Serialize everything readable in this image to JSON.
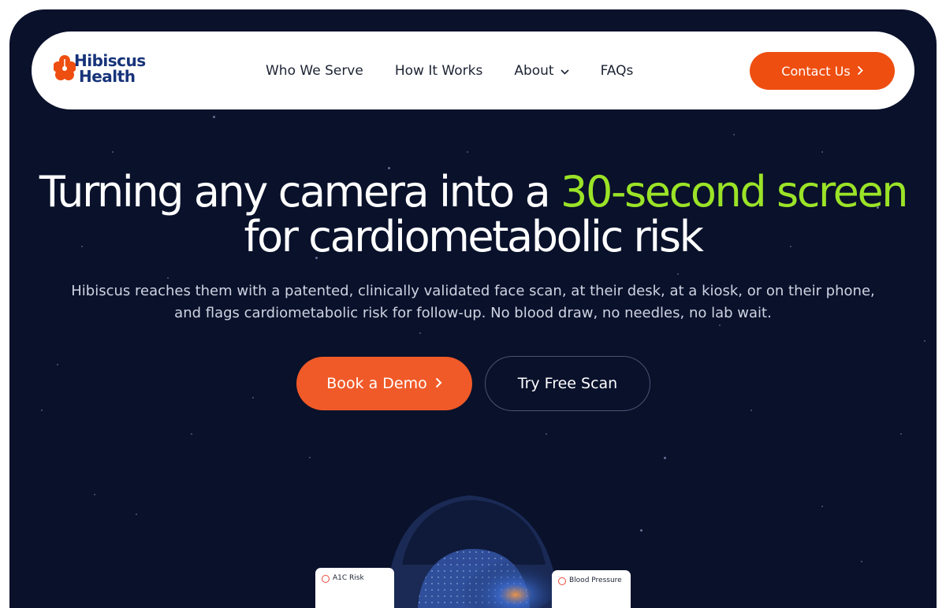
{
  "brand": {
    "name_line1": "Hibiscus",
    "name_line2": "Health",
    "brand_color": "#17337a",
    "flower_color": "#ee4e10"
  },
  "nav": {
    "links": [
      {
        "label": "Who We Serve",
        "has_dropdown": false
      },
      {
        "label": "How It Works",
        "has_dropdown": false
      },
      {
        "label": "About",
        "has_dropdown": true
      },
      {
        "label": "FAQs",
        "has_dropdown": false
      }
    ],
    "contact_label": "Contact Us",
    "contact_icon": "chevron-right-icon"
  },
  "hero": {
    "headline_before": "Turning any camera into a ",
    "headline_accent": "30-second screen",
    "headline_line2": "for cardiometabolic risk",
    "subtext_line1": "Hibiscus reaches them with a patented, clinically validated face scan, at their desk, at a kiosk, or on their phone,",
    "subtext_line2": "and flags cardiometabolic risk for follow-up. No blood draw, no needles, no lab wait.",
    "primary_cta": "Book a Demo",
    "secondary_cta": "Try Free Scan",
    "accent_color": "#9be327",
    "background_color": "#09112b",
    "cta_color": "#f05a28"
  },
  "scan_preview": {
    "badges": [
      {
        "label": "A1C Risk"
      },
      {
        "label": "Blood Pressure"
      }
    ]
  }
}
